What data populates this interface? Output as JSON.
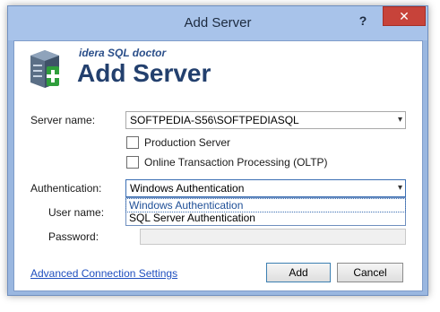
{
  "window": {
    "title": "Add Server",
    "help_label": "?",
    "close_label": "✕"
  },
  "header": {
    "brand": "idera SQL doctor",
    "title": "Add Server"
  },
  "form": {
    "server_name_label": "Server name:",
    "server_name_value": "SOFTPEDIA-S56\\SOFTPEDIASQL",
    "production_label": "Production Server",
    "oltp_label": "Online Transaction Processing (OLTP)",
    "authentication_label": "Authentication:",
    "authentication_value": "Windows Authentication",
    "user_name_label": "User name:",
    "password_label": "Password:"
  },
  "auth_options": [
    "Windows Authentication",
    "SQL Server Authentication"
  ],
  "footer": {
    "advanced_link": "Advanced Connection Settings",
    "add_button": "Add",
    "cancel_button": "Cancel"
  },
  "icons": {
    "server_add": "server-add-icon",
    "dropdown": "chevron-down-icon"
  }
}
